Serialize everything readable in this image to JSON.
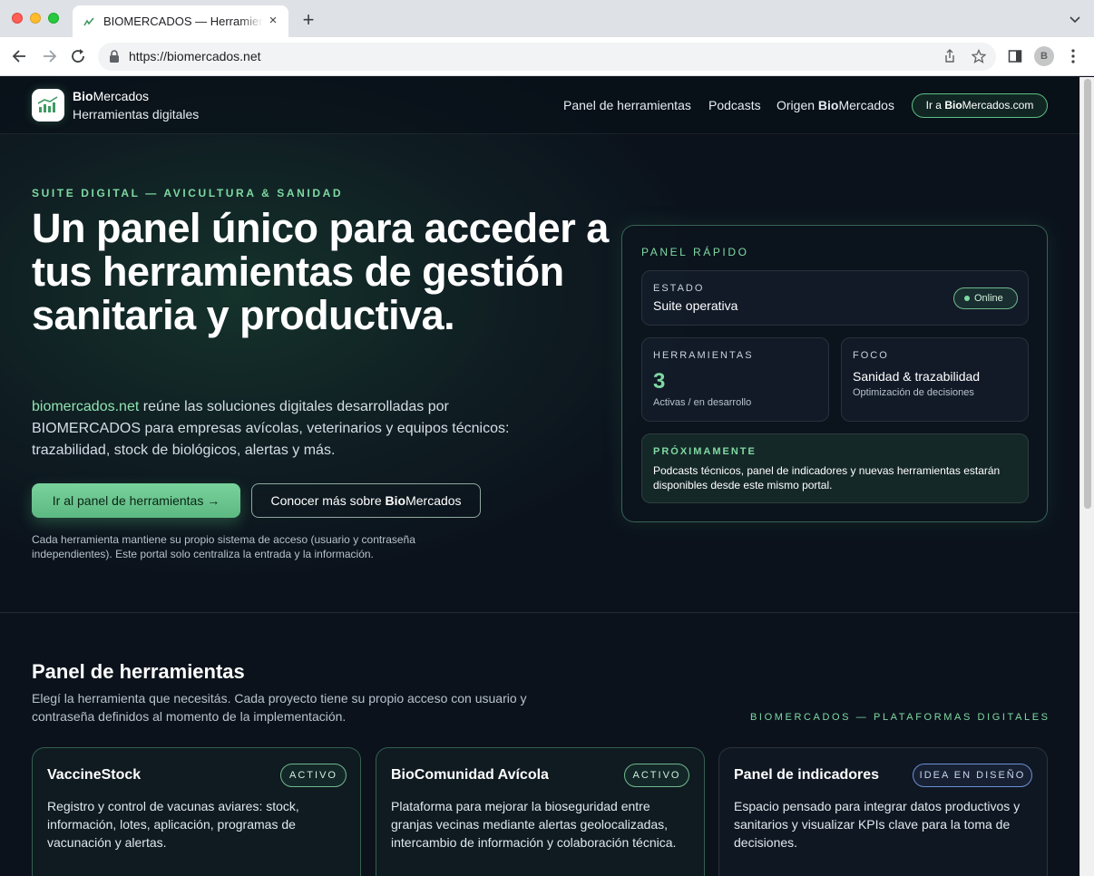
{
  "browser": {
    "tab_title": "BIOMERCADOS — Herramientas digitales",
    "tab_close": "×",
    "new_tab": "+",
    "url": "https://biomercados.net",
    "profile_initial": "B"
  },
  "header": {
    "brand_strong": "Bio",
    "brand_rest": "Mercados",
    "brand_sub": "Herramientas digitales",
    "nav": {
      "tools": "Panel de herramientas",
      "podcasts": "Podcasts",
      "origin_pre": "Origen ",
      "origin_strong": "Bio",
      "origin_rest": "Mercados"
    },
    "cta_pre": "Ir a ",
    "cta_strong": "Bio",
    "cta_rest": "Mercados.com"
  },
  "hero": {
    "eyebrow": "SUITE DIGITAL — AVICULTURA & SANIDAD",
    "title": "Un panel único para acceder a tus herramientas de gestión sanitaria y productiva.",
    "desc_highlight": "biomercados.net",
    "desc_rest": " reúne las soluciones digitales desarrolladas por BIOMERCADOS para empresas avícolas, veterinarios y equipos técnicos: trazabilidad, stock de biológicos, alertas y más.",
    "btn_primary": "Ir al panel de herramientas →",
    "btn_secondary_pre": "Conocer más sobre ",
    "btn_secondary_strong": "Bio",
    "btn_secondary_rest": "Mercados",
    "note": "Cada herramienta mantiene su propio sistema de acceso (usuario y contraseña independientes). Este portal solo centraliza la entrada y la información."
  },
  "quick_panel": {
    "label": "PANEL RÁPIDO",
    "status_key": "ESTADO",
    "status_value": "Suite operativa",
    "status_badge": "Online",
    "tools_key": "HERRAMIENTAS",
    "tools_count": "3",
    "tools_sub": "Activas / en desarrollo",
    "focus_key": "FOCO",
    "focus_value": "Sanidad & trazabilidad",
    "focus_sub": "Optimización de decisiones",
    "soon_key": "PRÓXIMAMENTE",
    "soon_text": "Podcasts técnicos, panel de indicadores y nuevas herramientas estarán disponibles desde este mismo portal."
  },
  "tools_section": {
    "title": "Panel de herramientas",
    "desc": "Elegí la herramienta que necesitás. Cada proyecto tiene su propio acceso con usuario y contraseña definidos al momento de la implementación.",
    "tag": "BIOMERCADOS — PLATAFORMAS DIGITALES",
    "cards": [
      {
        "title": "VaccineStock",
        "badge": "ACTIVO",
        "desc": "Registro y control de vacunas aviares: stock, información, lotes, aplicación, programas de vacunación y alertas."
      },
      {
        "title": "BioComunidad Avícola",
        "badge": "ACTIVO",
        "desc": "Plataforma para mejorar la bioseguridad entre granjas vecinas mediante alertas geolocalizadas, intercambio de información y colaboración técnica."
      },
      {
        "title": "Panel de indicadores",
        "badge": "IDEA EN DISEÑO",
        "desc": "Espacio pensado para integrar datos productivos y sanitarios y visualizar KPIs clave para la toma de decisiones."
      }
    ]
  }
}
